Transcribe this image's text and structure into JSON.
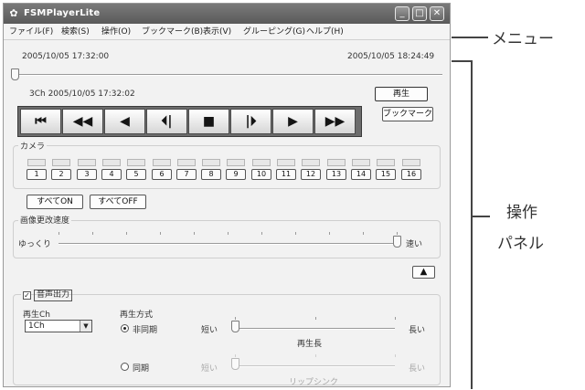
{
  "window": {
    "title": "FSMPlayerLite",
    "app_icon": "✿",
    "controls": {
      "minimize": "_",
      "maximize": "□",
      "close": "✕"
    }
  },
  "menu": [
    {
      "label": "ファイル(F)"
    },
    {
      "label": "検索(S)"
    },
    {
      "label": "操作(O)"
    },
    {
      "label": "ブックマーク(B)"
    },
    {
      "label": "表示(V)"
    },
    {
      "label": "グルーピング(G)"
    },
    {
      "label": "ヘルプ(H)"
    }
  ],
  "timeline": {
    "start": "2005/10/05 17:32:00",
    "end": "2005/10/05 18:24:49",
    "position": 0
  },
  "status": {
    "channel_time": "3Ch  2005/10/05 17:32:02"
  },
  "play_mode_box": "再生",
  "bookmark_button": "ブックマーク",
  "controls": [
    {
      "name": "skip-start",
      "glyph": "⏮"
    },
    {
      "name": "rewind",
      "glyph": "◀◀"
    },
    {
      "name": "play-reverse",
      "glyph": "◀"
    },
    {
      "name": "step-back",
      "glyph": "⏴|"
    },
    {
      "name": "stop",
      "glyph": "■"
    },
    {
      "name": "step-forward",
      "glyph": "|⏵"
    },
    {
      "name": "play",
      "glyph": "▶"
    },
    {
      "name": "fast-forward",
      "glyph": "▶▶"
    }
  ],
  "camera": {
    "label": "カメラ",
    "buttons": [
      "1",
      "2",
      "3",
      "4",
      "5",
      "6",
      "7",
      "8",
      "9",
      "10",
      "11",
      "12",
      "13",
      "14",
      "15",
      "16"
    ],
    "all_on": "すべてON",
    "all_off": "すべてOFF"
  },
  "refresh_speed": {
    "label": "画像更改速度",
    "left": "ゆっくり",
    "right": "速い",
    "value": 1
  },
  "collapse_arrow": "▲",
  "audio": {
    "checkbox_label": "音声出力",
    "checked": true,
    "channel_label": "再生Ch",
    "channel_value": "1Ch",
    "method_label": "再生方式",
    "async_label": "非同期",
    "sync_label": "同期",
    "selected": "非同期",
    "slider1": {
      "left": "短い",
      "right": "長い",
      "caption": "再生長",
      "value": 0
    },
    "slider2": {
      "left": "短い",
      "right": "長い",
      "caption": "リップシンク",
      "value": 0
    }
  },
  "annotations": {
    "menu": "メニュー",
    "panel_line1": "操作",
    "panel_line2": "パネル"
  }
}
